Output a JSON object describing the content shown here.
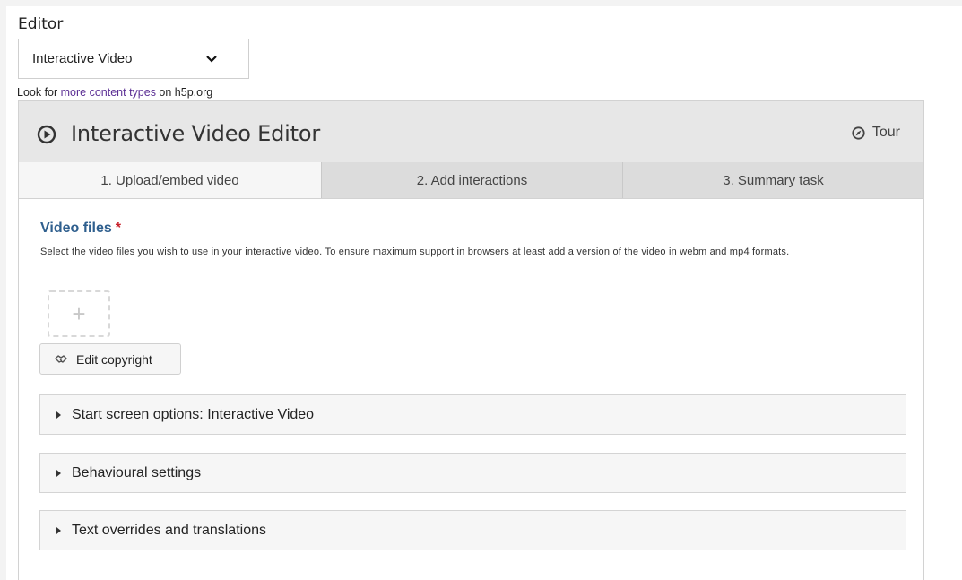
{
  "editor": {
    "label": "Editor",
    "content_type_selected": "Interactive Video",
    "look_for_prefix": "Look for ",
    "look_for_link": "more content types",
    "look_for_suffix": " on h5p.org"
  },
  "panel": {
    "title": "Interactive Video Editor",
    "tour_label": "Tour",
    "tabs": [
      {
        "label": "1. Upload/embed video",
        "active": true
      },
      {
        "label": "2. Add interactions",
        "active": false
      },
      {
        "label": "3. Summary task",
        "active": false
      }
    ]
  },
  "video_files": {
    "title": "Video files",
    "required_marker": "*",
    "description": "Select the video files you wish to use in your interactive video. To ensure maximum support in browsers at least add a version of the video in webm and mp4 formats.",
    "add_glyph": "+",
    "edit_copyright_label": "Edit copyright"
  },
  "accordions": [
    {
      "label": "Start screen options: Interactive Video"
    },
    {
      "label": "Behavioural settings"
    },
    {
      "label": "Text overrides and translations"
    }
  ],
  "icons": {
    "play": "play-circle-icon",
    "tour": "compass-icon",
    "chevron": "chevron-down-icon",
    "copyright": "handshake-icon",
    "expand": "triangle-right-icon"
  },
  "colors": {
    "section_title": "#2f5f8e",
    "required": "#c8202a",
    "link": "#5b2f94"
  }
}
